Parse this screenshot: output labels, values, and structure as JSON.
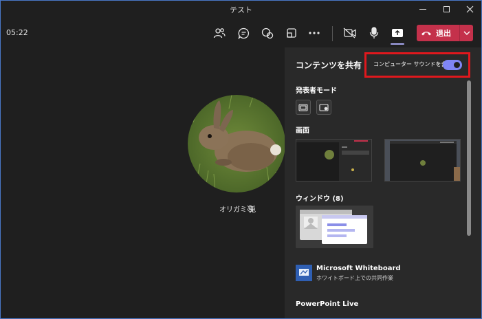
{
  "window": {
    "title": "テスト"
  },
  "toolbar": {
    "timer": "05:22",
    "leave_label": "退出",
    "icons": [
      "people-icon",
      "chat-icon",
      "reactions-icon",
      "rooms-icon",
      "more-icon",
      "camera-off-icon",
      "mic-icon",
      "share-icon"
    ]
  },
  "participant": {
    "name": "オリガミ 兎"
  },
  "share_panel": {
    "title": "コンテンツを共有",
    "include_sound_label": "コンピューター サウンドを含む",
    "include_sound_on": true,
    "presenter_mode_label": "発表者モード",
    "screen_label": "画面",
    "window_label": "ウィンドウ (8)",
    "whiteboard_title": "Microsoft Whiteboard",
    "whiteboard_subtitle": "ホワイトボード上での共同作業",
    "powerpoint_label": "PowerPoint Live"
  },
  "colors": {
    "leave": "#c4314b",
    "accent": "#7f85f5",
    "highlight": "#e0181d"
  }
}
